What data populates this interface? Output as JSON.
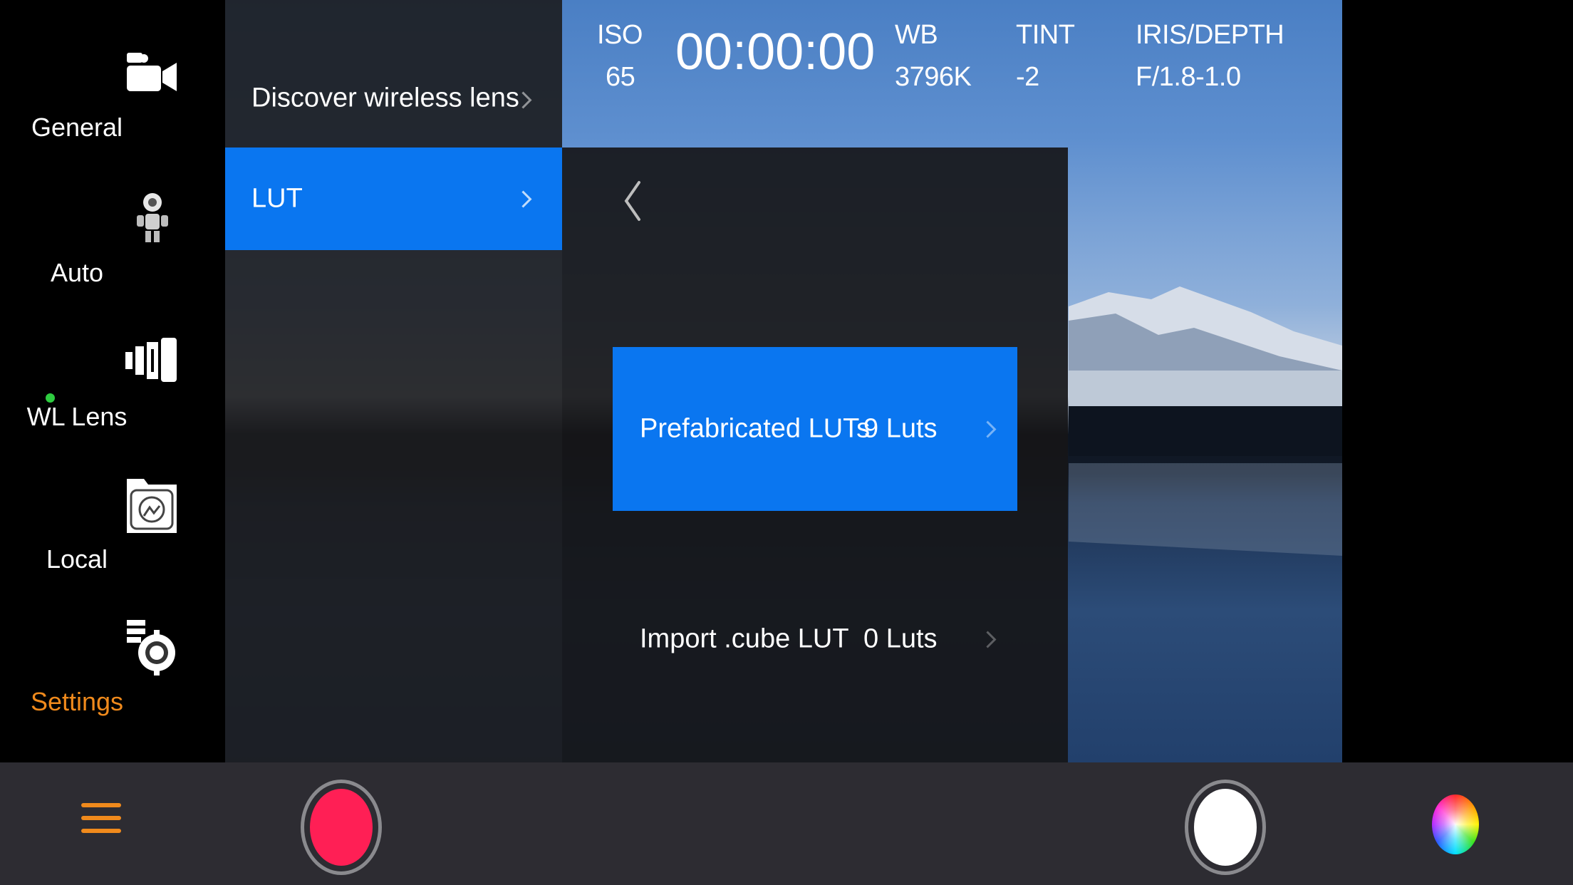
{
  "sidebar": {
    "items": [
      {
        "label": "General",
        "icon": "camera-icon"
      },
      {
        "label": "Auto",
        "icon": "robot-icon"
      },
      {
        "label": "WL Lens",
        "icon": "lens-icon"
      },
      {
        "label": "Local",
        "icon": "folder-photo-icon"
      },
      {
        "label": "Settings",
        "icon": "gear-icon",
        "active": true
      }
    ],
    "active_color": "#f08a1c",
    "status_dot_color": "#2ecc40"
  },
  "hud": {
    "iso_label": "ISO",
    "iso_value": "65",
    "timecode": "00:00:00",
    "wb_label": "WB",
    "wb_value": "3796K",
    "tint_label": "TINT",
    "tint_value": "-2",
    "iris_label": "IRIS/DEPTH",
    "iris_value": "F/1.8-1.0"
  },
  "menu": {
    "items": [
      {
        "label": "Discover wireless lens"
      },
      {
        "label": "LUT",
        "selected": true
      }
    ],
    "selected_color": "#0a76f0"
  },
  "lut": {
    "prefab_label": "Prefabricated LUTs",
    "prefab_count": "9  Luts",
    "import_label": "Import .cube LUT",
    "import_count": "0  Luts"
  },
  "bottom": {
    "menu_icon": "hamburger-icon",
    "record_color": "#ff1f55",
    "photo_color": "#ffffff",
    "color_icon": "color-wheel-icon"
  }
}
